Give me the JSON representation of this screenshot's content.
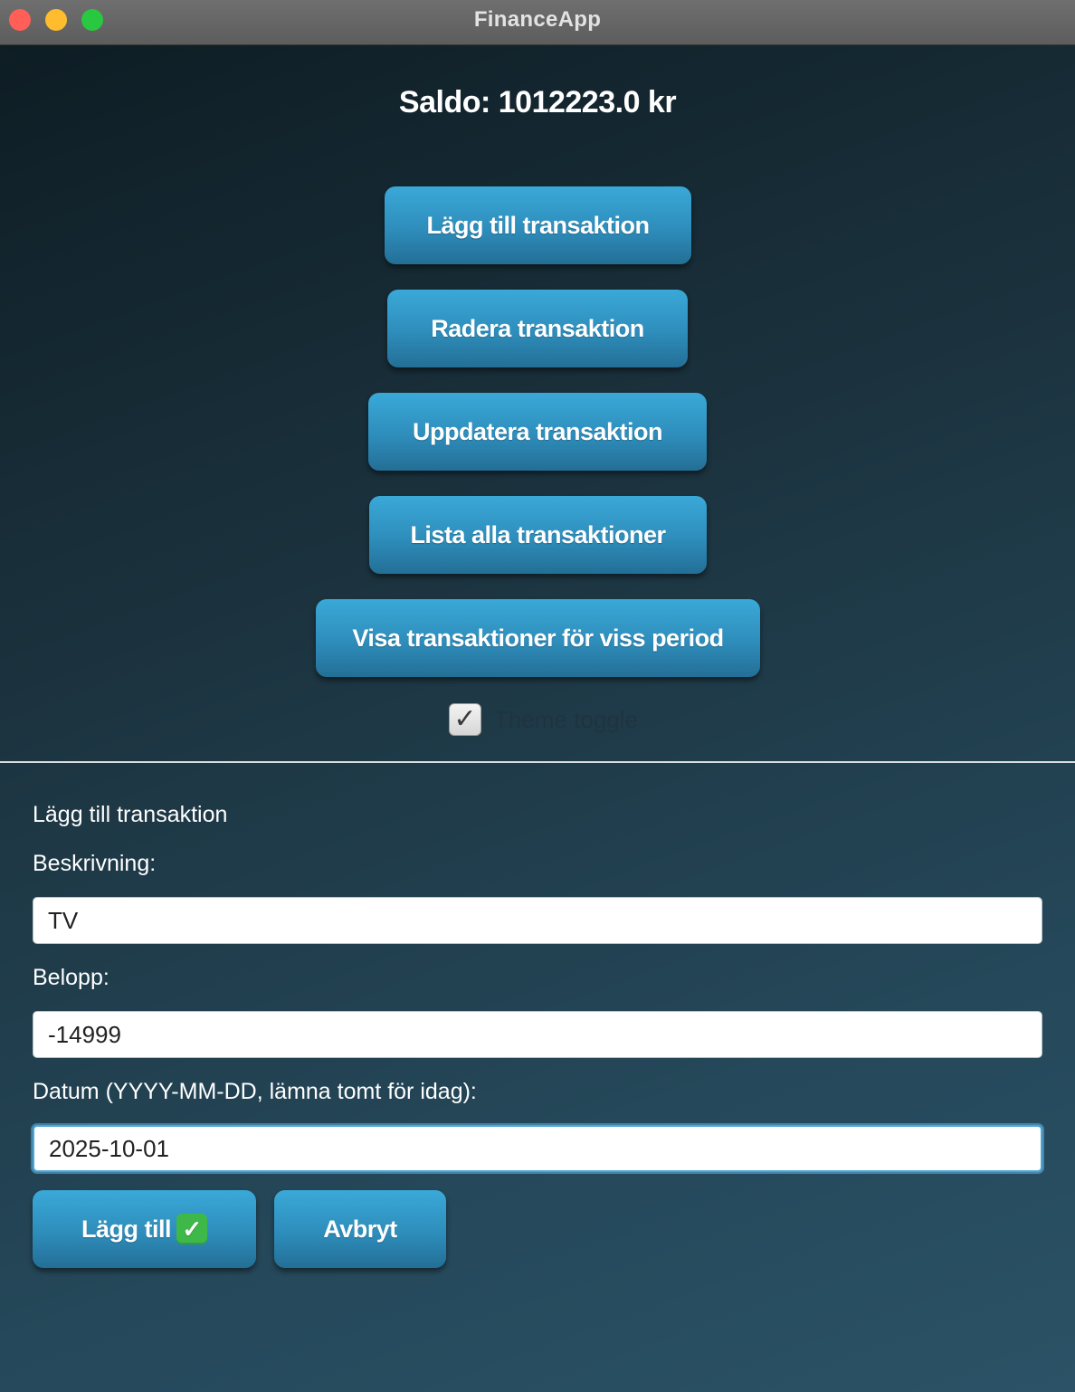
{
  "window": {
    "title": "FinanceApp"
  },
  "balance": {
    "text": "Saldo: 1012223.0 kr"
  },
  "menu": {
    "add_label": "Lägg till transaktion",
    "delete_label": "Radera transaktion",
    "update_label": "Uppdatera transaktion",
    "list_label": "Lista alla transaktioner",
    "period_label": "Visa transaktioner för viss period"
  },
  "theme_toggle": {
    "label": "Theme toggle",
    "checked": true,
    "icon": "checkmark-icon"
  },
  "form": {
    "title": "Lägg till transaktion",
    "description_label": "Beskrivning:",
    "description_value": "TV",
    "amount_label": "Belopp:",
    "amount_value": "-14999",
    "date_label": "Datum (YYYY-MM-DD, lämna tomt för idag):",
    "date_value": "2025-10-01",
    "submit_label": "Lägg till",
    "submit_icon": "green-checkmark-icon",
    "cancel_label": "Avbryt"
  },
  "colors": {
    "button_top": "#3aa9d8",
    "button_bottom": "#236f96",
    "focus_ring": "#4aa6d6",
    "close": "#ff5f57",
    "minimize": "#febc2e",
    "maximize": "#28c840"
  }
}
